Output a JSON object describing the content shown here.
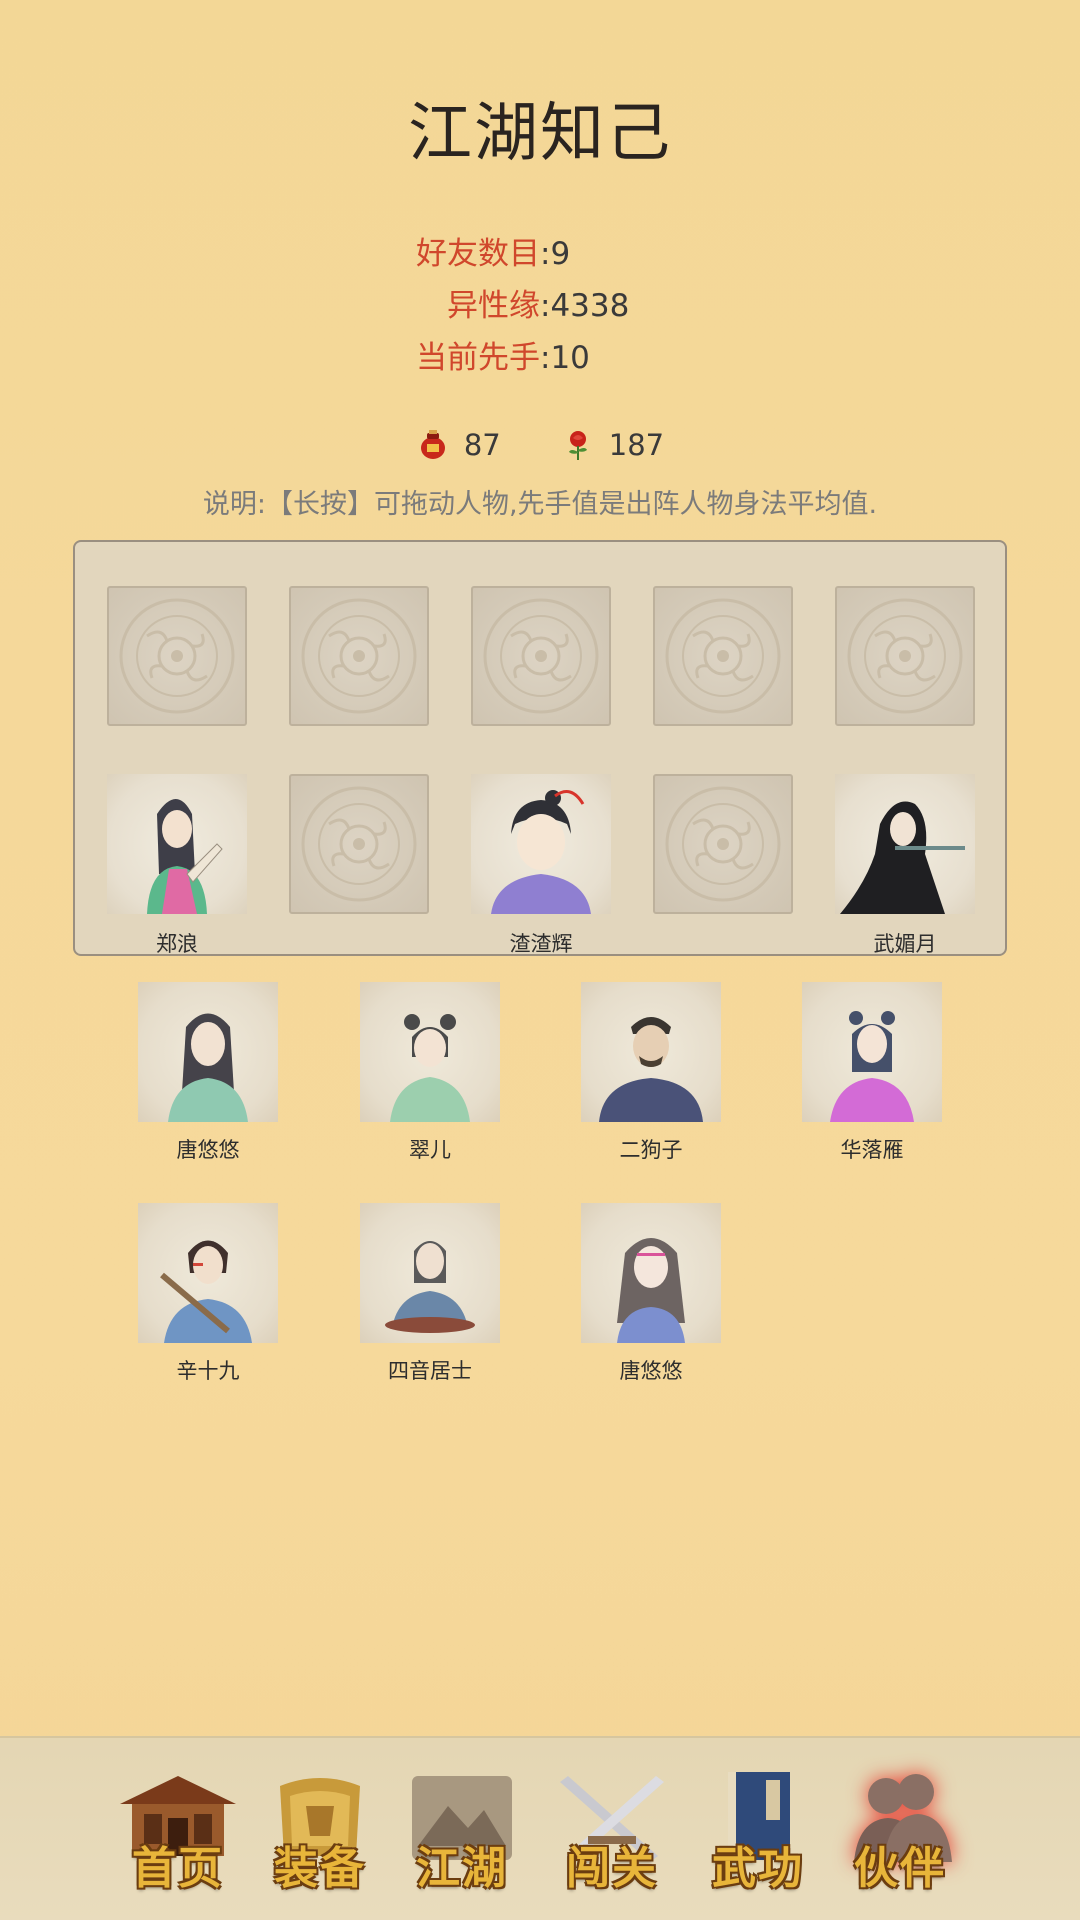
{
  "title": "江湖知己",
  "stats": [
    {
      "label": "好友数目",
      "value": "9"
    },
    {
      "label": "异性缘",
      "value": "4338"
    },
    {
      "label": "当前先手",
      "value": "10"
    }
  ],
  "resources": [
    {
      "icon": "wine-jar-icon",
      "value": "87"
    },
    {
      "icon": "rose-icon",
      "value": "187"
    }
  ],
  "description": "说明:【长按】可拖动人物,先手值是出阵人物身法平均值.",
  "team": {
    "row1": [
      null,
      null,
      null,
      null,
      null
    ],
    "row2": [
      "郑浪",
      null,
      "渣渣辉",
      null,
      "武媚月"
    ]
  },
  "reserve": [
    {
      "name": "唐悠悠",
      "color": "#8fc9b1"
    },
    {
      "name": "翠儿",
      "color": "#9ccfae"
    },
    {
      "name": "二狗子",
      "color": "#4a5278"
    },
    {
      "name": "华落雁",
      "color": "#d36bd6"
    },
    {
      "name": "辛十九",
      "color": "#6f95c4"
    },
    {
      "name": "四音居士",
      "color": "#6a87a8"
    },
    {
      "name": "唐悠悠",
      "color": "#7c8fcf"
    }
  ],
  "nav": [
    {
      "label": "首页",
      "icon": "house-icon"
    },
    {
      "label": "装备",
      "icon": "armor-icon"
    },
    {
      "label": "江湖",
      "icon": "scroll-map-icon"
    },
    {
      "label": "闯关",
      "icon": "crossed-swords-icon"
    },
    {
      "label": "武功",
      "icon": "book-icon"
    },
    {
      "label": "伙伴",
      "icon": "partners-icon",
      "active": true
    }
  ]
}
